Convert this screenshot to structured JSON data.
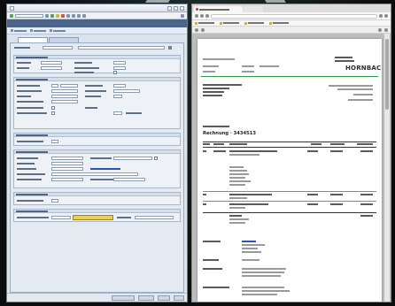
{
  "sap": {
    "window_title": "",
    "app_title": "",
    "tabs": [
      "",
      ""
    ]
  },
  "pdf": {
    "tab_title": "",
    "logo_text": "HORNBACH",
    "logo_color": "#2f9a47",
    "doc_title": "Rechnung · 3434513",
    "accent_link_color": "#2a55b8"
  },
  "desktop": {
    "background": "#0c0f10"
  }
}
